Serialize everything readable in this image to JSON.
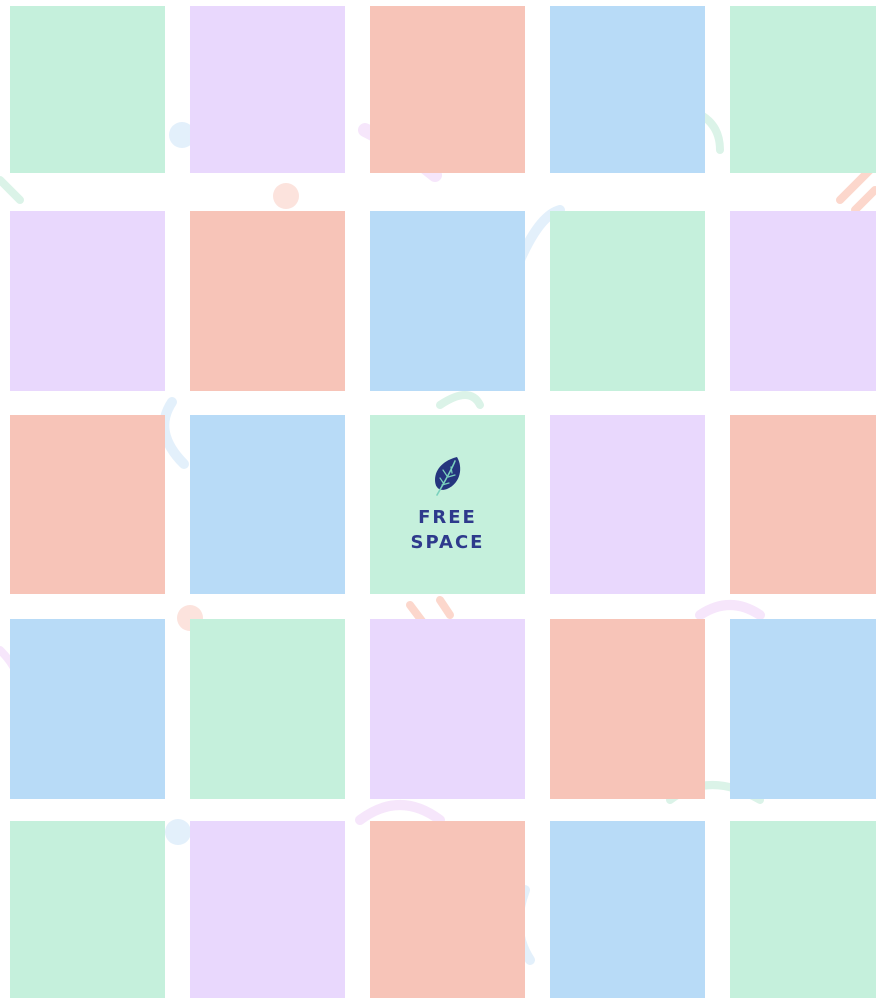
{
  "colors": {
    "background": "#ffffff",
    "green": "#c5f0dc",
    "purple": "#e9d8fd",
    "salmon": "#f7c4b8",
    "blue": "#b8dbf7",
    "text": "#2e3a8c",
    "leaf": "#25357e",
    "leaf_vein": "#7ad1bd"
  },
  "board": {
    "cells": [
      [
        "green",
        "purple",
        "salmon",
        "blue",
        "green"
      ],
      [
        "purple",
        "salmon",
        "blue",
        "green",
        "purple"
      ],
      [
        "salmon",
        "blue",
        "free",
        "purple",
        "salmon"
      ],
      [
        "blue",
        "green",
        "purple",
        "salmon",
        "blue"
      ],
      [
        "green",
        "purple",
        "salmon",
        "blue",
        "green"
      ]
    ],
    "free_space": {
      "label": "FREE\nSPACE",
      "icon": "leaf-icon"
    }
  }
}
